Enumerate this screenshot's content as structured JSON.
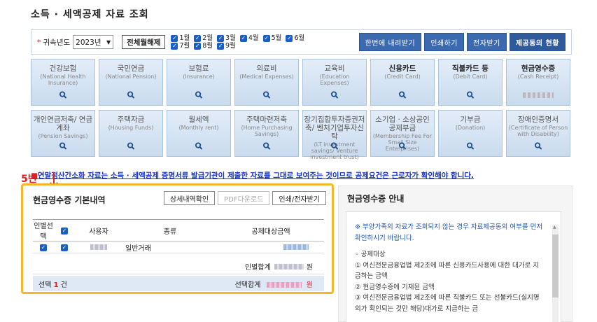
{
  "page": {
    "title": "소득 · 세액공제 자료 조회"
  },
  "filter": {
    "required_mark": "*",
    "year_label": "귀속년도",
    "year_value": "2023년",
    "toggle_all_label": "전체월해제",
    "months": [
      {
        "label": "1월",
        "checked": true
      },
      {
        "label": "2월",
        "checked": true
      },
      {
        "label": "3월",
        "checked": true
      },
      {
        "label": "4월",
        "checked": true
      },
      {
        "label": "5월",
        "checked": true
      },
      {
        "label": "6월",
        "checked": true
      },
      {
        "label": "7월",
        "checked": true
      },
      {
        "label": "8월",
        "checked": true
      },
      {
        "label": "9월",
        "checked": true
      }
    ],
    "buttons": {
      "download": "한번에 내려받기",
      "print": "인쇄하기",
      "email": "전자받기",
      "consent": "제공동의 현황"
    }
  },
  "tiles": [
    {
      "title": "건강보험",
      "sub": "(National Health Insurance)"
    },
    {
      "title": "국민연금",
      "sub": "(National Pension)"
    },
    {
      "title": "보험료",
      "sub": "(Insurance)"
    },
    {
      "title": "의료비",
      "sub": "(Medical Expenses)"
    },
    {
      "title": "교육비",
      "sub": "(Education Expenses)"
    },
    {
      "title": "신용카드",
      "sub": "(Credit Card)"
    },
    {
      "title": "직불카드 등",
      "sub": "(Debit Card)"
    },
    {
      "title": "현금영수증",
      "sub": "(Cash Receipt)"
    },
    {
      "title": "개인연금저축/ 연금계좌",
      "sub": "(Pension Savings)"
    },
    {
      "title": "주택자금",
      "sub": "(Housing Funds)"
    },
    {
      "title": "월세액",
      "sub": "(Monthly rent)"
    },
    {
      "title": "주택마련저축",
      "sub": "(Home Purchasing Savings)"
    },
    {
      "title": "장기집합투자증권저축/ 벤처기업투자신탁",
      "sub": "(LT investment savings/ Venture investment trust)"
    },
    {
      "title": "소기업 · 소상공인 공제부금",
      "sub": "(Membership Fee For Small Size Enterprises)"
    },
    {
      "title": "기부금",
      "sub": "(Donation)"
    },
    {
      "title": "장애인증명서",
      "sub": "(Certificate of Person with Disability)"
    }
  ],
  "notice": {
    "bullet": "■",
    "text": "연말정산간소화 자료는 소득 · 세액공제 증명서류 발급기관이 제출한 자료를 그대로 보여주는 것이므로 공제요건은 근로자가 확인해야 합니다."
  },
  "annotation": {
    "step": "5번"
  },
  "left_panel": {
    "title": "현금영수증 기본내역",
    "buttons": {
      "detail": "상세내역확인",
      "pdf": "PDF다운로드",
      "print": "인쇄/전자받기"
    },
    "table": {
      "headers": [
        "인별선택",
        "사용자",
        "종류",
        "공제대상금액"
      ],
      "rows": [
        {
          "type": "일반거래",
          "person_checked": true,
          "row_checked": true
        }
      ]
    },
    "subtotal_label": "인별합계",
    "total_label": "선택합계",
    "won": "원",
    "selected_prefix": "선택",
    "selected_count": "1",
    "selected_suffix": "건"
  },
  "right_panel": {
    "title": "현금영수증 안내",
    "notes": [
      "※ 부양가족의 자료가 조회되지 않는 경우 자료제공동의 여부를 먼저 확인하시기 바랍니다.",
      "◦ 공제대상",
      "① 여신전문금융업법 제2조에 따른 신용카드사용에 대한 대가로 지급하는 금액",
      "② 현금영수증에 기재된 금액",
      "③ 여신전문금융업법 제2조에 따른 직불카드 또는 선불카드(실지명의가 확인되는 것만 해당)대가로 지급하는 금"
    ]
  }
}
